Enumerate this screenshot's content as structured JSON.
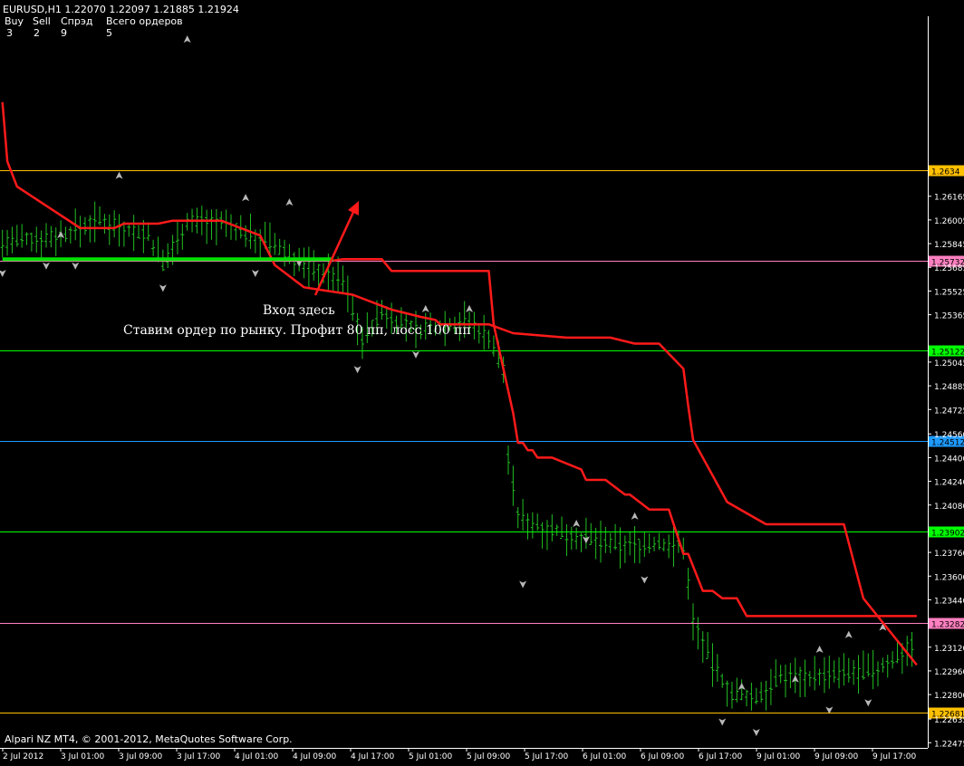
{
  "header": {
    "symbol_line": "EURUSD,H1  1.22070 1.22097 1.21885 1.21924",
    "col_labels": [
      "Buy",
      "Sell",
      "Спрэд",
      "Всего ордеров"
    ],
    "col_values": [
      "3",
      "2",
      "9",
      "5"
    ]
  },
  "footer": {
    "copyright": "Alpari NZ MT4, © 2001-2012, MetaQuotes Software Corp."
  },
  "annotation": {
    "line1": "Вход здесь",
    "line2": "Ставим ордер по рынку. Профит 80 пп, лосс 100 пп"
  },
  "chart_data": {
    "type": "line",
    "symbol": "EURUSD",
    "timeframe": "H1",
    "ylim": [
      1.2244,
      1.2738
    ],
    "y_ticks": [
      "1.26165",
      "1.26005",
      "1.25845",
      "1.25685",
      "1.25525",
      "1.25365",
      "1.25045",
      "1.24885",
      "1.24725",
      "1.24560",
      "1.24400",
      "1.24240",
      "1.24080",
      "1.23760",
      "1.23600",
      "1.23440",
      "1.23120",
      "1.22960",
      "1.22800",
      "1.22635",
      "1.22475"
    ],
    "x_ticks": [
      "2 Jul 2012",
      "3 Jul 01:00",
      "3 Jul 09:00",
      "3 Jul 17:00",
      "4 Jul 01:00",
      "4 Jul 09:00",
      "4 Jul 17:00",
      "5 Jul 01:00",
      "5 Jul 09:00",
      "5 Jul 17:00",
      "6 Jul 01:00",
      "6 Jul 09:00",
      "6 Jul 17:00",
      "9 Jul 01:00",
      "9 Jul 09:00",
      "9 Jul 17:00"
    ],
    "levels": [
      {
        "price": 1.2634,
        "label": "1.2634",
        "color": "#ffc000"
      },
      {
        "price": 1.25732,
        "label": "1.25732",
        "color": "#ff80c0"
      },
      {
        "price": 1.25122,
        "label": "1.25122",
        "color": "#00ff00"
      },
      {
        "price": 1.24512,
        "label": "1.24512",
        "color": "#1e9bff"
      },
      {
        "price": 1.23902,
        "label": "1.23902",
        "color": "#00ff00"
      },
      {
        "price": 1.23282,
        "label": "1.23282",
        "color": "#ff80c0"
      },
      {
        "price": 1.22681,
        "label": "1.22681",
        "color": "#ffc000"
      }
    ],
    "series": [
      {
        "color": "#ff1a1a",
        "x": [
          0,
          1,
          3,
          16,
          23,
          25,
          32,
          35,
          45,
          53,
          56,
          62,
          66,
          72,
          80,
          86,
          89,
          90,
          100,
          105,
          116,
          125,
          130,
          135,
          140,
          141,
          142,
          149,
          157,
          163,
          173,
          177,
          188
        ],
        "values": [
          1.268,
          1.264,
          1.2623,
          1.2595,
          1.2595,
          1.2598,
          1.2598,
          1.26,
          1.26,
          1.259,
          1.257,
          1.2555,
          1.2553,
          1.255,
          1.254,
          1.2535,
          1.2533,
          1.253,
          1.253,
          1.2524,
          1.2521,
          1.2521,
          1.2517,
          1.2517,
          1.25,
          1.2475,
          1.2452,
          1.241,
          1.2395,
          1.2395,
          1.2395,
          1.2345,
          1.23
        ]
      },
      {
        "color": "#ff1a1a",
        "x": [
          68,
          70,
          78,
          80,
          100,
          101,
          103,
          105,
          106,
          107,
          108,
          109,
          110,
          113,
          119,
          120,
          124,
          128,
          129,
          133,
          137,
          140,
          141,
          144,
          146,
          148,
          151,
          153,
          188
        ],
        "values": [
          1.2573,
          1.2574,
          1.2574,
          1.2566,
          1.2566,
          1.253,
          1.25,
          1.247,
          1.245,
          1.245,
          1.2445,
          1.2445,
          1.244,
          1.244,
          1.2432,
          1.2425,
          1.2425,
          1.2415,
          1.2415,
          1.2405,
          1.2405,
          1.2375,
          1.2375,
          1.235,
          1.235,
          1.2345,
          1.2345,
          1.2333,
          1.2333
        ]
      },
      {
        "color": "#00e000",
        "x": [
          0,
          68
        ],
        "values": [
          1.2574,
          1.2574
        ]
      }
    ]
  }
}
